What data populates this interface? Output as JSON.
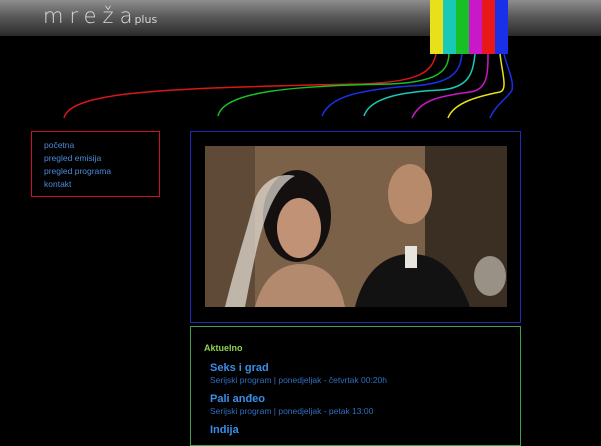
{
  "header": {
    "logo_main": "mreža",
    "logo_sub": "plus",
    "color_bars": [
      "#e8e01a",
      "#1ac8b8",
      "#18c028",
      "#c818c8",
      "#e81818",
      "#1830e8"
    ]
  },
  "nav": {
    "items": [
      {
        "label": "početna"
      },
      {
        "label": "pregled emisija"
      },
      {
        "label": "pregled programa"
      },
      {
        "label": "kontakt"
      }
    ]
  },
  "news": {
    "title": "Aktuelno",
    "items": [
      {
        "title": "Seks i grad",
        "schedule": "Serijski program | ponedjeljak - četvrtak 00:20h"
      },
      {
        "title": "Pali anđeo",
        "schedule": "Serijski program | ponedjeljak - petak 13:00"
      },
      {
        "title": "Indija",
        "schedule": ""
      }
    ]
  },
  "colors": {
    "nav_border": "#c8102e",
    "video_border": "#1d2bb8",
    "news_border": "#3aa34a",
    "news_heading": "#8fd14f",
    "link": "#3a8ee8"
  }
}
